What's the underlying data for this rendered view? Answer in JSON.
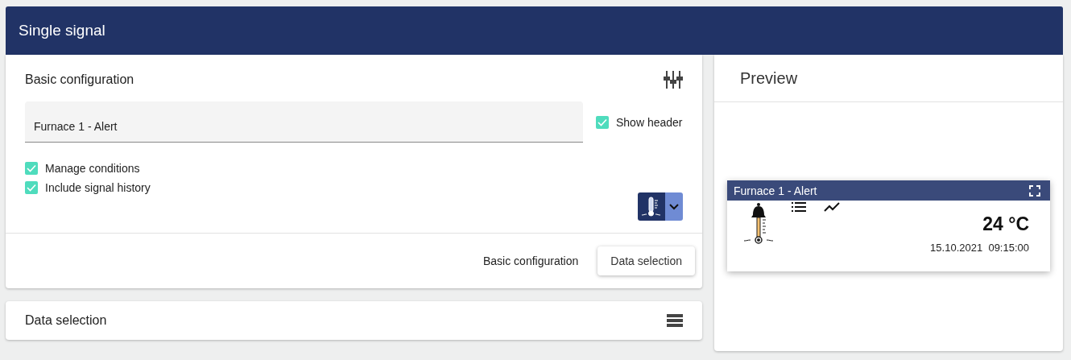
{
  "header": {
    "title": "Single signal"
  },
  "basic_configuration": {
    "title": "Basic configuration",
    "name_field": {
      "value": "Furnace 1 - Alert"
    },
    "options": [
      {
        "label": "Show header",
        "checked": true
      },
      {
        "label": "Manage conditions",
        "checked": true
      },
      {
        "label": "Include signal history",
        "checked": true
      }
    ],
    "footer": {
      "current_step": "Basic configuration",
      "next_button": "Data selection"
    }
  },
  "data_selection": {
    "title": "Data selection"
  },
  "preview": {
    "title": "Preview",
    "widget": {
      "title": "Furnace 1 - Alert",
      "value": "24 °C",
      "timestamp": "15.10.2021  09:15:00"
    }
  }
}
